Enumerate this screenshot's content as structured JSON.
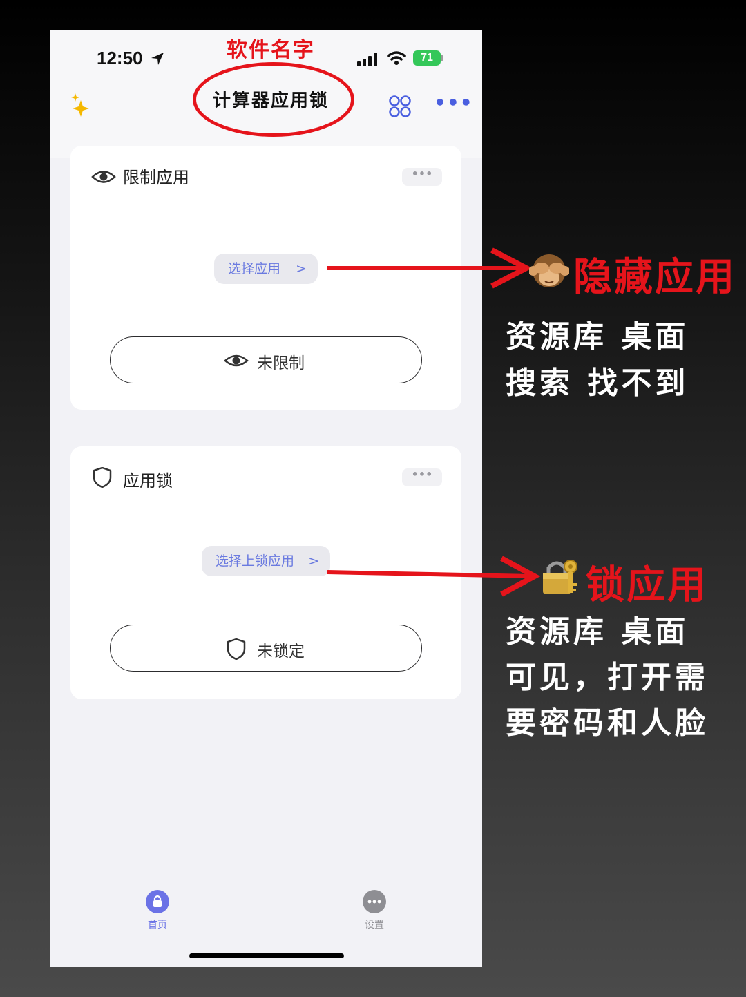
{
  "status_bar": {
    "time": "12:50",
    "battery": "71"
  },
  "annotations": {
    "app_name": "软件名字",
    "hide_title": "隐藏应用",
    "hide_desc": [
      "资源库 桌面",
      "搜索 找不到"
    ],
    "lock_title": "锁应用",
    "lock_desc": [
      "资源库 桌面",
      "可见，打开需",
      "要密码和人脸"
    ]
  },
  "nav": {
    "title": "计算器应用锁",
    "more": "•••"
  },
  "cards": [
    {
      "title": "限制应用",
      "menu": "•••",
      "select_label": "选择应用",
      "status_label": "未限制"
    },
    {
      "title": "应用锁",
      "menu": "•••",
      "select_label": "选择上锁应用",
      "status_label": "未锁定"
    }
  ],
  "tabbar": [
    {
      "label": "首页",
      "color": "#6b72e6"
    },
    {
      "label": "设置",
      "color": "#8e8e93"
    }
  ],
  "colors": {
    "accent": "#4a5fe0",
    "annotation_red": "#e5141b",
    "battery_green": "#34c759"
  }
}
